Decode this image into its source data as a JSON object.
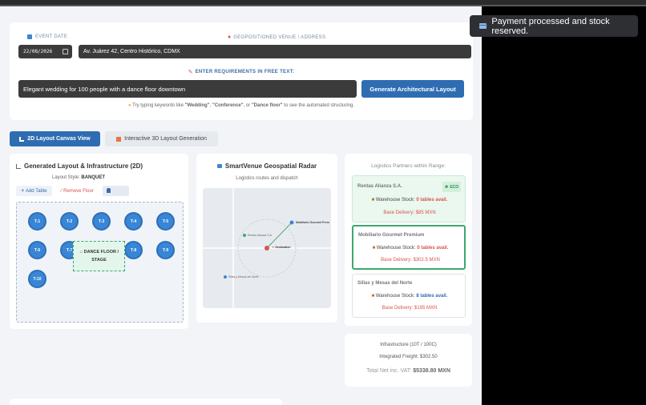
{
  "toast": {
    "message": "Payment processed and stock reserved."
  },
  "event": {
    "date_label": "EVENT DATE",
    "date_value": "22/08/2026",
    "venue_label": "GEOPOSITIONED VENUE / ADDRESS",
    "venue_value": "Av. Juárez 42, Centro Histórico, CDMX",
    "requirements_label": "ENTER REQUIREMENTS IN FREE TEXT:",
    "requirements_value": "Elegant wedding for 100 people with a dance floor downtown",
    "generate_button": "Generate Architectural Layout",
    "hint_prefix": "Try typing keywords like ",
    "hint_k1": "\"Wedding\"",
    "hint_sep1": ", ",
    "hint_k2": "\"Conference\"",
    "hint_sep2": ", or ",
    "hint_k3": "\"Dance floor\"",
    "hint_suffix": " to see the automated structuring."
  },
  "tabs": {
    "tab_2d": "2D Layout Canvas View",
    "tab_3d": "Interactive 3D Layout Generation"
  },
  "layout": {
    "title": "Generated Layout & Infrastructure (2D)",
    "style_label": "Layout Style: ",
    "style_value": "BANQUET",
    "add_table": "Add Table",
    "remove_floor": "Remove Floor",
    "tables": [
      "T-1",
      "T-2",
      "T-3",
      "T-4",
      "T-5",
      "T-6",
      "T-7",
      "T-8",
      "T-9",
      "T-10"
    ],
    "dance_floor_line1": "DANCE FLOOR /",
    "dance_floor_line2": "STAGE"
  },
  "radar": {
    "title": "SmartVenue Geospatial Radar",
    "subtitle": "Logistics routes and dispatch",
    "destination": "Destination",
    "p1": "Rentas Alianza S.A.",
    "p2": "Mobiliario Gourmet Prem",
    "p3": "Sillas y Mesas del Norte"
  },
  "partners": {
    "header": "Logistics Partners within Range:",
    "items": [
      {
        "name": "Rentas Alianza S.A.",
        "badge": "ECO",
        "stock_label": "Warehouse Stock: ",
        "stock_value": "0 tables avail.",
        "delivery": "Base Delivery: $85 MXN"
      },
      {
        "name": "Mobiliario Gourmet Premium",
        "stock_label": "Warehouse Stock: ",
        "stock_value": "0 tables avail.",
        "delivery": "Base Delivery: $302.5 MXN"
      },
      {
        "name": "Sillas y Mesas del Norte",
        "stock_label": "Warehouse Stock: ",
        "stock_value": "8 tables avail.",
        "delivery": "Base Delivery: $195 MXN"
      }
    ]
  },
  "totals": {
    "infrastructure": "Infrastructure (10T / 100C)",
    "freight": "Integrated Freight: $302.50",
    "net_label": "Total Net inc. VAT: ",
    "net_value": "$5338.80 MXN"
  },
  "colors": {
    "accent": "#2f6db3",
    "eco_green": "#e9f8ee",
    "danger": "#d9534f"
  }
}
